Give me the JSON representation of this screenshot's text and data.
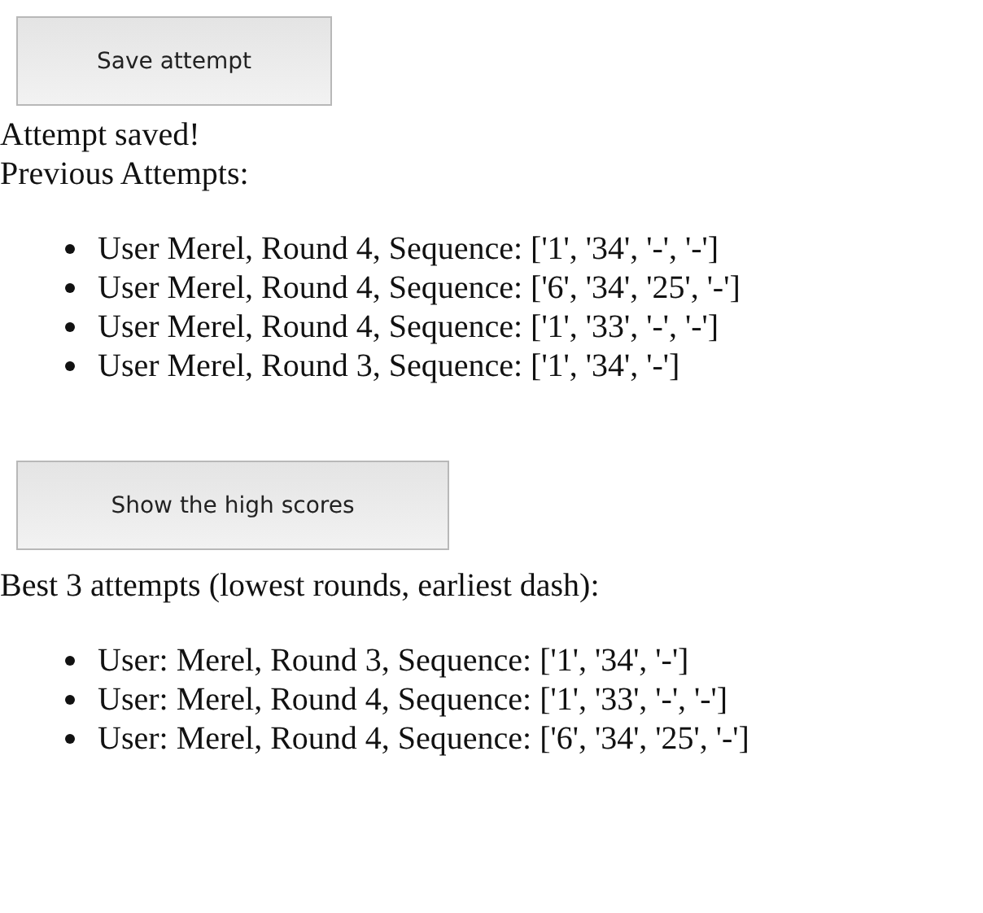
{
  "save_button": {
    "label": "Save attempt"
  },
  "status": "Attempt saved!",
  "previous_heading": "Previous Attempts:",
  "previous_attempts": [
    {
      "text": "User Merel, Round 4, Sequence: ['1', '34', '-', '-']"
    },
    {
      "text": "User Merel, Round 4, Sequence: ['6', '34', '25', '-']"
    },
    {
      "text": "User Merel, Round 4, Sequence: ['1', '33', '-', '-']"
    },
    {
      "text": "User Merel, Round 3, Sequence: ['1', '34', '-']"
    }
  ],
  "high_scores_button": {
    "label": "Show the high scores"
  },
  "best_heading": "Best 3 attempts (lowest rounds, earliest dash):",
  "best_attempts": [
    {
      "text": "User: Merel, Round 3, Sequence: ['1', '34', '-']"
    },
    {
      "text": "User: Merel, Round 4, Sequence: ['1', '33', '-', '-']"
    },
    {
      "text": "User: Merel, Round 4, Sequence: ['6', '34', '25', '-']"
    }
  ]
}
